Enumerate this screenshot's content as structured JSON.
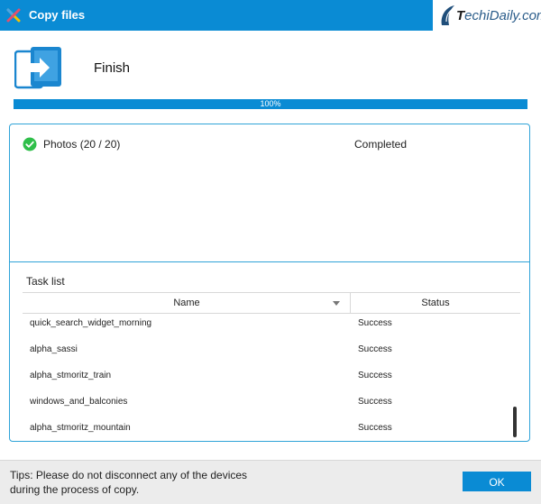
{
  "window": {
    "title": "Copy files",
    "watermark": {
      "brand_prefix": "T",
      "brand_bold": "echiDaily",
      "brand_suffix": ".com"
    }
  },
  "header": {
    "status_title": "Finish",
    "icon": "device-transfer-icon"
  },
  "progress": {
    "value": 1.0,
    "text": "100%"
  },
  "summary": {
    "item": {
      "icon": "check-circle-icon",
      "name": "Photos (20 / 20)",
      "status": "Completed"
    }
  },
  "task_list": {
    "label": "Task list",
    "columns": {
      "name": "Name",
      "status": "Status"
    },
    "rows": [
      {
        "name": "quick_search_widget_morning",
        "status": "Success"
      },
      {
        "name": "alpha_sassi",
        "status": "Success"
      },
      {
        "name": "alpha_stmoritz_train",
        "status": "Success"
      },
      {
        "name": "windows_and_balconies",
        "status": "Success"
      },
      {
        "name": "alpha_stmoritz_mountain",
        "status": "Success"
      }
    ]
  },
  "footer": {
    "tips_line1": "Tips: Please do not disconnect any of the devices",
    "tips_line2": "during the process of copy.",
    "ok_label": "OK"
  },
  "colors": {
    "accent": "#0a8bd4",
    "success": "#2fbf4a",
    "panel_border": "#2fa3d8"
  }
}
